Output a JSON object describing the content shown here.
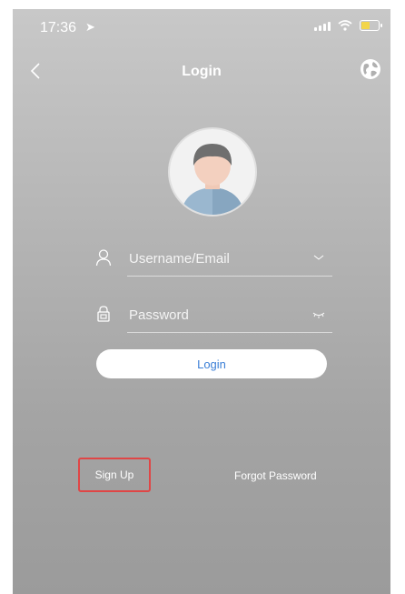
{
  "status_bar": {
    "time": "17:36",
    "battery_level": 0.45
  },
  "nav": {
    "title": "Login"
  },
  "form": {
    "username_placeholder": "Username/Email",
    "password_placeholder": "Password",
    "login_label": "Login"
  },
  "links": {
    "signup_label": "Sign Up",
    "forgot_label": "Forgot Password"
  },
  "colors": {
    "login_text": "#3b7fd6",
    "highlight_border": "#e04646",
    "battery_fill": "#f2d54a"
  },
  "icons": [
    "location-arrow-icon",
    "signal-icon",
    "wifi-icon",
    "battery-icon",
    "back-chevron-icon",
    "globe-icon",
    "avatar-icon",
    "user-icon",
    "chevron-down-icon",
    "lock-icon",
    "eye-closed-icon"
  ]
}
